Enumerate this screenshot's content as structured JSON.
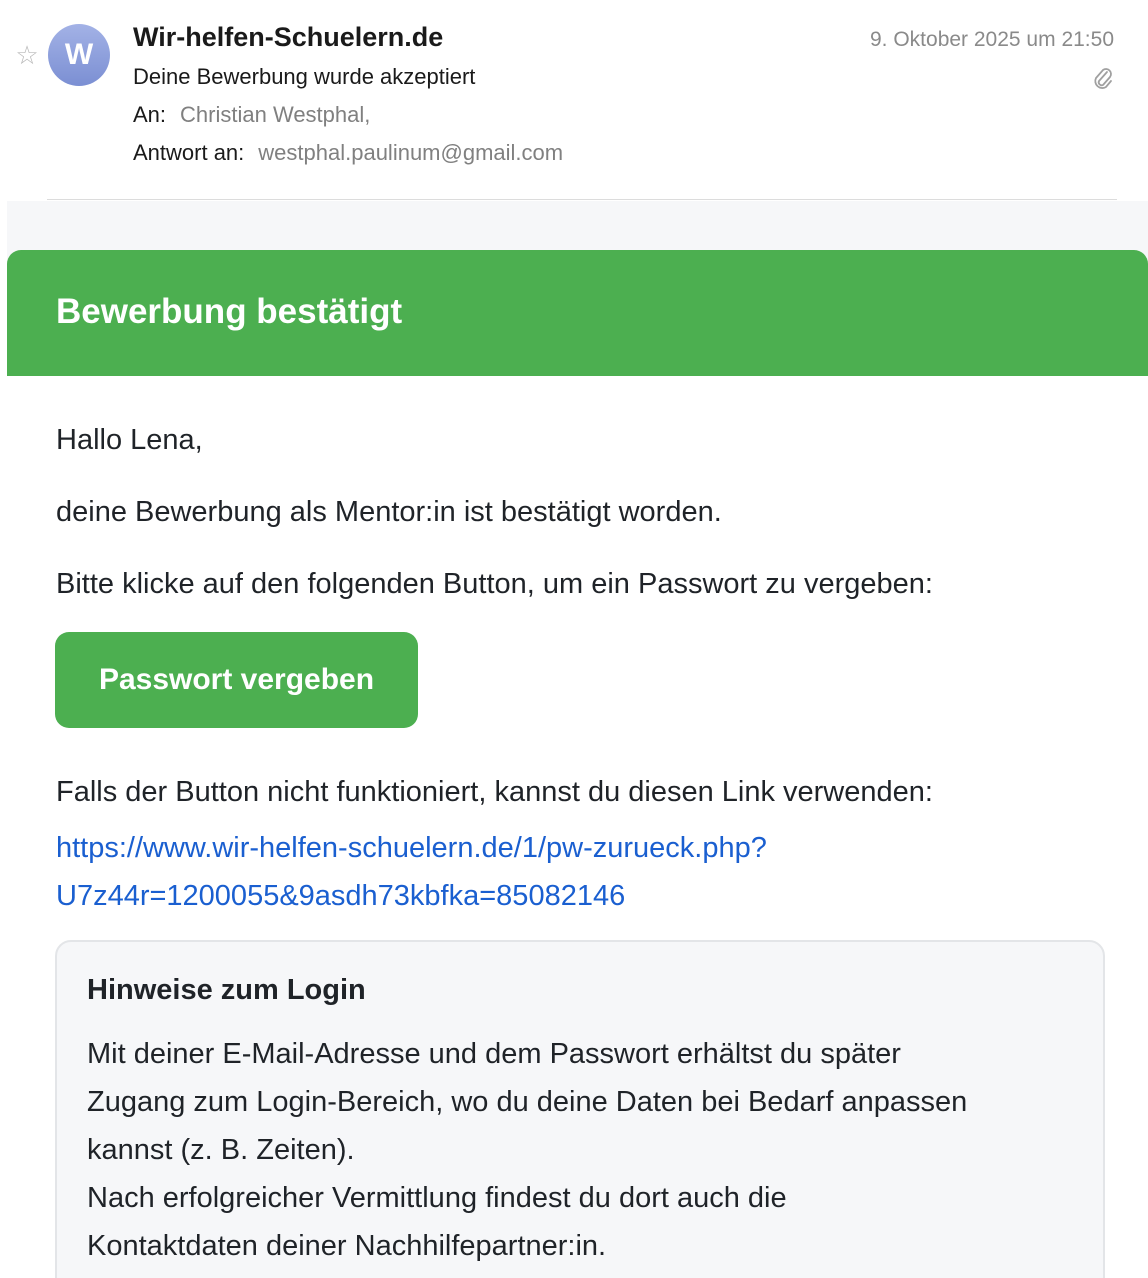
{
  "header": {
    "star_icon": "star-outline-icon",
    "avatar_initial": "W",
    "sender": "Wir-helfen-Schuelern.de",
    "date": "9. Oktober 2025 um 21:50",
    "attachment_icon": "paperclip-icon",
    "subject": "Deine Bewerbung wurde akzeptiert",
    "to_label": "An:",
    "to_value": "Christian Westphal,",
    "reply_label": "Antwort an:",
    "reply_value": "westphal.paulinum@gmail.com"
  },
  "body": {
    "banner_title": "Bewerbung bestätigt",
    "banner_color": "#4caf50",
    "greeting": "Hallo Lena,",
    "confirmation": "deine Bewerbung als Mentor:in ist bestätigt worden.",
    "instruction": "Bitte klicke auf den folgenden Button, um ein Passwort zu vergeben:",
    "button_label": "Passwort vergeben",
    "fallback_text": "Falls der Button nicht funktioniert, kannst du diesen Link verwenden:",
    "link_line1": "https://www.wir-helfen-schuelern.de/1/pw-zurueck.php?",
    "link_line2": "U7z44r=1200055&9asdh73kbfka=85082146",
    "link_color": "#1a5fd0"
  },
  "info_box": {
    "title": "Hinweise zum Login",
    "lines": [
      "Mit deiner E-Mail-Adresse und dem Passwort erhältst du später",
      "Zugang zum Login-Bereich, wo du deine Daten bei Bedarf anpassen",
      "kannst (z. B. Zeiten).",
      "Nach erfolgreicher Vermittlung findest du dort auch die",
      "Kontaktdaten deiner Nachhilfepartner:in."
    ]
  }
}
